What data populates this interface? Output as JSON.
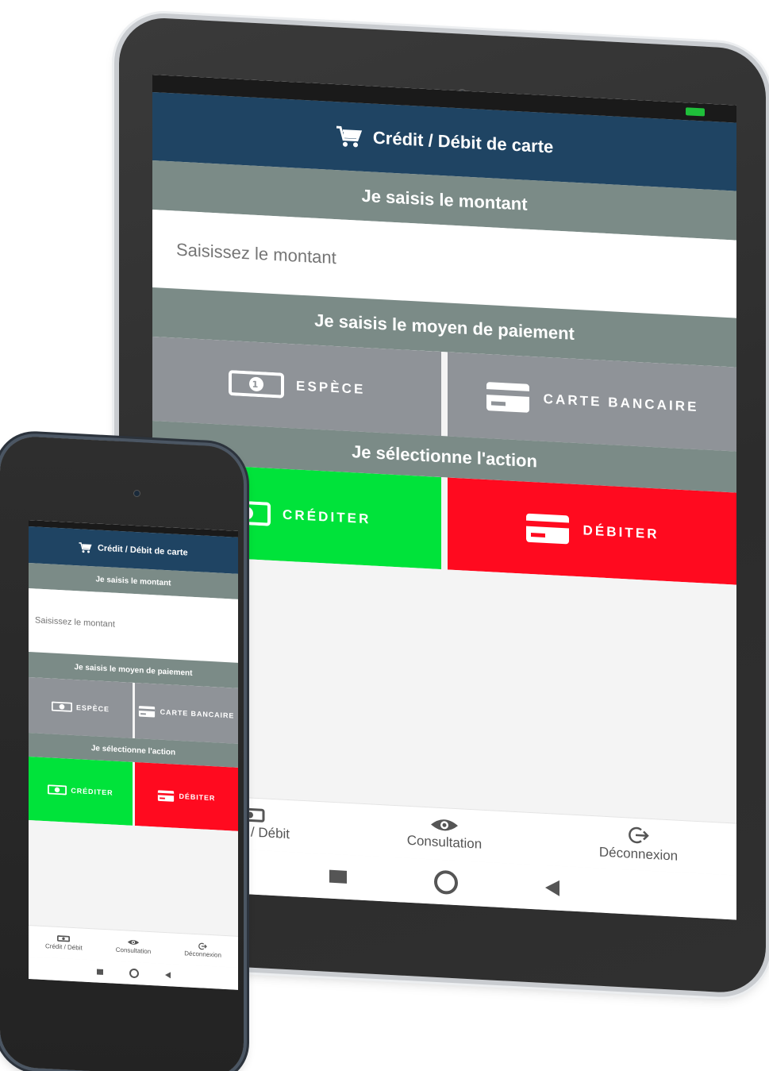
{
  "app": {
    "header_title": "Crédit / Débit de carte",
    "section_amount": "Je saisis le montant",
    "amount_placeholder": "Saisissez le montant",
    "section_payment": "Je saisis le moyen de paiement",
    "payment_cash": "ESPÈCE",
    "payment_card": "CARTE BANCAIRE",
    "section_action": "Je sélectionne l'action",
    "action_credit": "CRÉDITER",
    "action_debit": "DÉBITER"
  },
  "nav": {
    "items": [
      {
        "label": "Crédit / Débit",
        "icon": "cash-icon"
      },
      {
        "label": "Consultation",
        "icon": "eye-icon"
      },
      {
        "label": "Déconnexion",
        "icon": "logout-icon"
      }
    ]
  },
  "system_nav": [
    "recents-button",
    "home-button",
    "back-button"
  ],
  "colors": {
    "header": "#1f4463",
    "section": "#7b8b87",
    "payment_tile": "#8f9398",
    "credit": "#00e33a",
    "debit": "#ff0a1f"
  }
}
